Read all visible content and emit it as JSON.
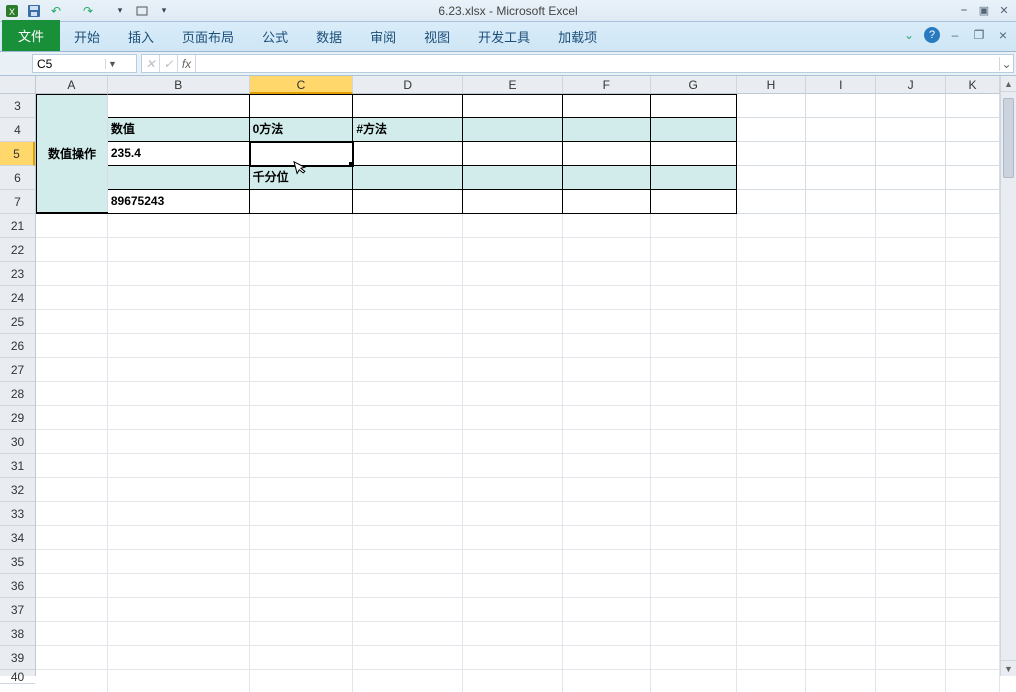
{
  "app": {
    "title": "6.23.xlsx - Microsoft Excel"
  },
  "qat": {
    "excel_icon": "X",
    "save": "💾",
    "undo": "↶",
    "redo": "↷"
  },
  "wincontrols": {
    "min": "⎯",
    "max": "▣",
    "close": "✕"
  },
  "ribbon": {
    "file": "文件",
    "tabs": [
      "开始",
      "插入",
      "页面布局",
      "公式",
      "数据",
      "审阅",
      "视图",
      "开发工具",
      "加载项"
    ],
    "help_tip": "?",
    "chevron": "⌄"
  },
  "mdi": {
    "min": "–",
    "restore": "❐",
    "close": "×"
  },
  "namebox": {
    "value": "C5"
  },
  "formula": {
    "fx": "fx",
    "value": ""
  },
  "columns": [
    "A",
    "B",
    "C",
    "D",
    "E",
    "F",
    "G",
    "H",
    "I",
    "J",
    "K"
  ],
  "selected_col_index": 2,
  "row_labels": [
    "3",
    "4",
    "5",
    "6",
    "7",
    "21",
    "22",
    "23",
    "24",
    "25",
    "26",
    "27",
    "28",
    "29",
    "30",
    "31",
    "32",
    "33",
    "34",
    "35",
    "36",
    "37",
    "38",
    "39",
    "40"
  ],
  "selected_row_label": "5",
  "sheet": {
    "mergedA": "数值操作",
    "B4": "数值",
    "C4": "0方法",
    "D4": "#方法",
    "B5": "235.4",
    "C6": "千分位",
    "B7": "89675243"
  },
  "chart_data": {
    "type": "table",
    "title": "数值操作",
    "columns": [
      "数值",
      "0方法",
      "#方法"
    ],
    "rows": [
      {
        "数值": 235.4,
        "0方法": null,
        "#方法": null
      },
      {
        "数值": null,
        "0方法": "千分位",
        "#方法": null
      },
      {
        "数值": 89675243,
        "0方法": null,
        "#方法": null
      }
    ]
  }
}
